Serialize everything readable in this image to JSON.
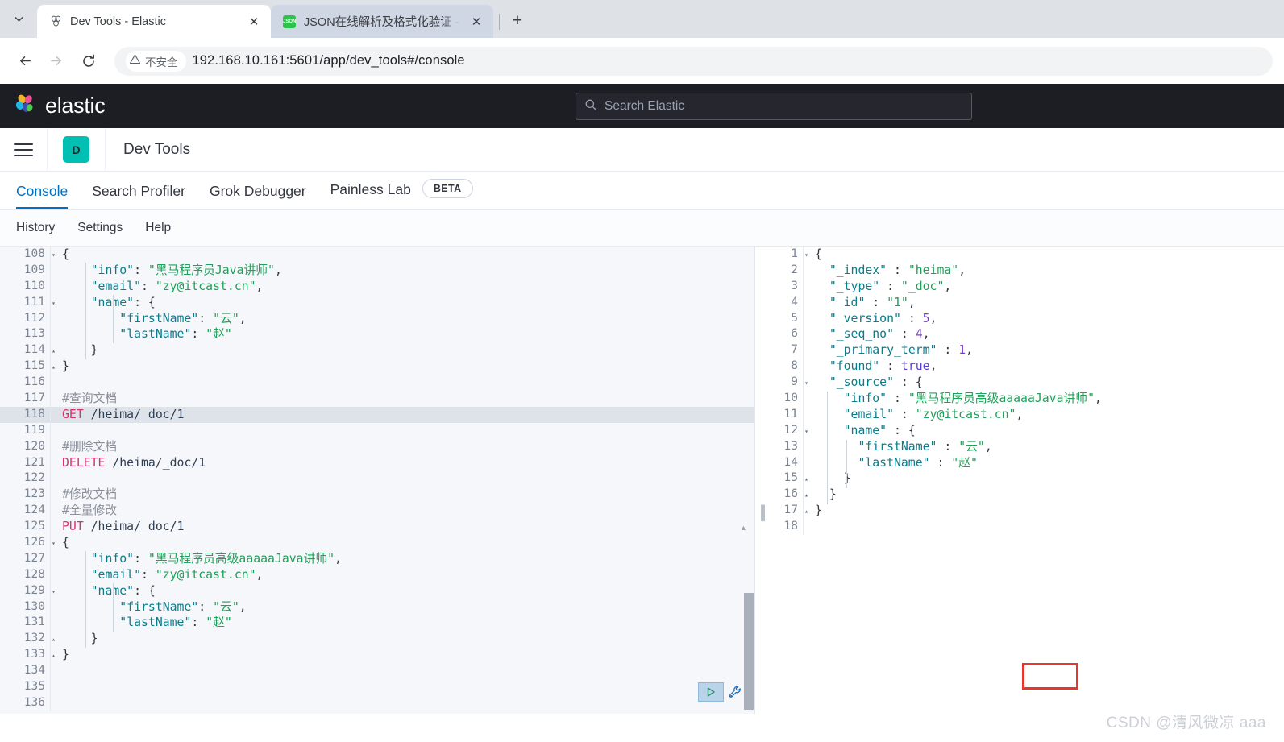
{
  "browser": {
    "tab_list_icon": "chevron-down-icon",
    "tabs": [
      {
        "title": "Dev Tools - Elastic",
        "favicon": "elastic-favicon",
        "active": true,
        "close_label": "✕"
      },
      {
        "title": "JSON在线解析及格式化验证 - J",
        "favicon": "json-favicon",
        "active": false,
        "close_label": "✕"
      }
    ],
    "new_tab_label": "+",
    "back_label": "←",
    "forward_label": "→",
    "reload_label": "⟳",
    "security_label": "不安全",
    "security_icon": "warning-triangle-icon",
    "url": "192.168.10.161:5601/app/dev_tools#/console"
  },
  "elastic": {
    "brand_name": "elastic",
    "brand_icon": "elastic-logo-icon",
    "search_placeholder": "Search Elastic",
    "search_icon": "search-icon",
    "menu_icon": "hamburger-menu-icon",
    "app_avatar_letter": "D",
    "app_title": "Dev Tools",
    "accent_color": "#0071c2",
    "avatar_color": "#00bfb3",
    "tabs": [
      {
        "label": "Console",
        "active": true,
        "badge": null
      },
      {
        "label": "Search Profiler",
        "active": false,
        "badge": null
      },
      {
        "label": "Grok Debugger",
        "active": false,
        "badge": null
      },
      {
        "label": "Painless Lab",
        "active": false,
        "badge": "BETA"
      }
    ],
    "subnav": [
      {
        "label": "History"
      },
      {
        "label": "Settings"
      },
      {
        "label": "Help"
      }
    ]
  },
  "console": {
    "run_icon": "play-triangle-icon",
    "wrench_icon": "wrench-icon",
    "divider_icon": "resize-handle-icon",
    "active_line": 118,
    "editor_lines": [
      {
        "num": "108",
        "fold": "▾",
        "tokens": [
          {
            "t": "{",
            "c": "p"
          }
        ]
      },
      {
        "num": "109",
        "fold": "",
        "tokens": [
          {
            "t": "    ",
            "c": "p"
          },
          {
            "t": "\"info\"",
            "c": "k"
          },
          {
            "t": ": ",
            "c": "p"
          },
          {
            "t": "\"黑马程序员Java讲师\"",
            "c": "s"
          },
          {
            "t": ",",
            "c": "p"
          }
        ]
      },
      {
        "num": "110",
        "fold": "",
        "tokens": [
          {
            "t": "    ",
            "c": "p"
          },
          {
            "t": "\"email\"",
            "c": "k"
          },
          {
            "t": ": ",
            "c": "p"
          },
          {
            "t": "\"zy@itcast.cn\"",
            "c": "s"
          },
          {
            "t": ",",
            "c": "p"
          }
        ]
      },
      {
        "num": "111",
        "fold": "▾",
        "tokens": [
          {
            "t": "    ",
            "c": "p"
          },
          {
            "t": "\"name\"",
            "c": "k"
          },
          {
            "t": ": ",
            "c": "p"
          },
          {
            "t": "{",
            "c": "p"
          }
        ]
      },
      {
        "num": "112",
        "fold": "",
        "tokens": [
          {
            "t": "        ",
            "c": "p"
          },
          {
            "t": "\"firstName\"",
            "c": "k"
          },
          {
            "t": ": ",
            "c": "p"
          },
          {
            "t": "\"云\"",
            "c": "s"
          },
          {
            "t": ",",
            "c": "p"
          }
        ]
      },
      {
        "num": "113",
        "fold": "",
        "tokens": [
          {
            "t": "        ",
            "c": "p"
          },
          {
            "t": "\"lastName\"",
            "c": "k"
          },
          {
            "t": ": ",
            "c": "p"
          },
          {
            "t": "\"赵\"",
            "c": "s"
          }
        ]
      },
      {
        "num": "114",
        "fold": "▴",
        "tokens": [
          {
            "t": "    }",
            "c": "p"
          }
        ]
      },
      {
        "num": "115",
        "fold": "▴",
        "tokens": [
          {
            "t": "}",
            "c": "p"
          }
        ]
      },
      {
        "num": "116",
        "fold": "",
        "tokens": []
      },
      {
        "num": "117",
        "fold": "",
        "tokens": [
          {
            "t": "#查询文档",
            "c": "c"
          }
        ]
      },
      {
        "num": "118",
        "fold": "",
        "tokens": [
          {
            "t": "GET",
            "c": "m"
          },
          {
            "t": " /heima/_doc/1",
            "c": "u"
          }
        ]
      },
      {
        "num": "119",
        "fold": "",
        "tokens": []
      },
      {
        "num": "120",
        "fold": "",
        "tokens": [
          {
            "t": "#删除文档",
            "c": "c"
          }
        ]
      },
      {
        "num": "121",
        "fold": "",
        "tokens": [
          {
            "t": "DELETE",
            "c": "m"
          },
          {
            "t": " /heima/_doc/1",
            "c": "u"
          }
        ]
      },
      {
        "num": "122",
        "fold": "",
        "tokens": []
      },
      {
        "num": "123",
        "fold": "",
        "tokens": [
          {
            "t": "#修改文档",
            "c": "c"
          }
        ]
      },
      {
        "num": "124",
        "fold": "",
        "tokens": [
          {
            "t": "#全量修改",
            "c": "c"
          }
        ]
      },
      {
        "num": "125",
        "fold": "",
        "tokens": [
          {
            "t": "PUT",
            "c": "m"
          },
          {
            "t": " /heima/_doc/1",
            "c": "u"
          }
        ]
      },
      {
        "num": "126",
        "fold": "▾",
        "tokens": [
          {
            "t": "{",
            "c": "p"
          }
        ]
      },
      {
        "num": "127",
        "fold": "",
        "tokens": [
          {
            "t": "    ",
            "c": "p"
          },
          {
            "t": "\"info\"",
            "c": "k"
          },
          {
            "t": ": ",
            "c": "p"
          },
          {
            "t": "\"黑马程序员高级aaaaaJava讲师\"",
            "c": "s"
          },
          {
            "t": ",",
            "c": "p"
          }
        ]
      },
      {
        "num": "128",
        "fold": "",
        "tokens": [
          {
            "t": "    ",
            "c": "p"
          },
          {
            "t": "\"email\"",
            "c": "k"
          },
          {
            "t": ": ",
            "c": "p"
          },
          {
            "t": "\"zy@itcast.cn\"",
            "c": "s"
          },
          {
            "t": ",",
            "c": "p"
          }
        ]
      },
      {
        "num": "129",
        "fold": "▾",
        "tokens": [
          {
            "t": "    ",
            "c": "p"
          },
          {
            "t": "\"name\"",
            "c": "k"
          },
          {
            "t": ": ",
            "c": "p"
          },
          {
            "t": "{",
            "c": "p"
          }
        ]
      },
      {
        "num": "130",
        "fold": "",
        "tokens": [
          {
            "t": "        ",
            "c": "p"
          },
          {
            "t": "\"firstName\"",
            "c": "k"
          },
          {
            "t": ": ",
            "c": "p"
          },
          {
            "t": "\"云\"",
            "c": "s"
          },
          {
            "t": ",",
            "c": "p"
          }
        ]
      },
      {
        "num": "131",
        "fold": "",
        "tokens": [
          {
            "t": "        ",
            "c": "p"
          },
          {
            "t": "\"lastName\"",
            "c": "k"
          },
          {
            "t": ": ",
            "c": "p"
          },
          {
            "t": "\"赵\"",
            "c": "s"
          }
        ]
      },
      {
        "num": "132",
        "fold": "▴",
        "tokens": [
          {
            "t": "    }",
            "c": "p"
          }
        ]
      },
      {
        "num": "133",
        "fold": "▴",
        "tokens": [
          {
            "t": "}",
            "c": "p"
          }
        ]
      },
      {
        "num": "134",
        "fold": "",
        "tokens": []
      },
      {
        "num": "135",
        "fold": "",
        "tokens": []
      },
      {
        "num": "136",
        "fold": "",
        "tokens": []
      }
    ],
    "response_lines": [
      {
        "num": "1",
        "fold": "▾",
        "tokens": [
          {
            "t": "{",
            "c": "p"
          }
        ]
      },
      {
        "num": "2",
        "fold": "",
        "tokens": [
          {
            "t": "  ",
            "c": "p"
          },
          {
            "t": "\"_index\"",
            "c": "k"
          },
          {
            "t": " : ",
            "c": "p"
          },
          {
            "t": "\"heima\"",
            "c": "s"
          },
          {
            "t": ",",
            "c": "p"
          }
        ]
      },
      {
        "num": "3",
        "fold": "",
        "tokens": [
          {
            "t": "  ",
            "c": "p"
          },
          {
            "t": "\"_type\"",
            "c": "k"
          },
          {
            "t": " : ",
            "c": "p"
          },
          {
            "t": "\"_doc\"",
            "c": "s"
          },
          {
            "t": ",",
            "c": "p"
          }
        ]
      },
      {
        "num": "4",
        "fold": "",
        "tokens": [
          {
            "t": "  ",
            "c": "p"
          },
          {
            "t": "\"_id\"",
            "c": "k"
          },
          {
            "t": " : ",
            "c": "p"
          },
          {
            "t": "\"1\"",
            "c": "s"
          },
          {
            "t": ",",
            "c": "p"
          }
        ]
      },
      {
        "num": "5",
        "fold": "",
        "tokens": [
          {
            "t": "  ",
            "c": "p"
          },
          {
            "t": "\"_version\"",
            "c": "k"
          },
          {
            "t": " : ",
            "c": "p"
          },
          {
            "t": "5",
            "c": "n"
          },
          {
            "t": ",",
            "c": "p"
          }
        ]
      },
      {
        "num": "6",
        "fold": "",
        "tokens": [
          {
            "t": "  ",
            "c": "p"
          },
          {
            "t": "\"_seq_no\"",
            "c": "k"
          },
          {
            "t": " : ",
            "c": "p"
          },
          {
            "t": "4",
            "c": "n"
          },
          {
            "t": ",",
            "c": "p"
          }
        ]
      },
      {
        "num": "7",
        "fold": "",
        "tokens": [
          {
            "t": "  ",
            "c": "p"
          },
          {
            "t": "\"_primary_term\"",
            "c": "k"
          },
          {
            "t": " : ",
            "c": "p"
          },
          {
            "t": "1",
            "c": "n"
          },
          {
            "t": ",",
            "c": "p"
          }
        ]
      },
      {
        "num": "8",
        "fold": "",
        "tokens": [
          {
            "t": "  ",
            "c": "p"
          },
          {
            "t": "\"found\"",
            "c": "k"
          },
          {
            "t": " : ",
            "c": "p"
          },
          {
            "t": "true",
            "c": "b"
          },
          {
            "t": ",",
            "c": "p"
          }
        ]
      },
      {
        "num": "9",
        "fold": "▾",
        "tokens": [
          {
            "t": "  ",
            "c": "p"
          },
          {
            "t": "\"_source\"",
            "c": "k"
          },
          {
            "t": " : ",
            "c": "p"
          },
          {
            "t": "{",
            "c": "p"
          }
        ]
      },
      {
        "num": "10",
        "fold": "",
        "tokens": [
          {
            "t": "    ",
            "c": "p"
          },
          {
            "t": "\"info\"",
            "c": "k"
          },
          {
            "t": " : ",
            "c": "p"
          },
          {
            "t": "\"黑马程序员高级aaaaaJava讲师\"",
            "c": "s"
          },
          {
            "t": ",",
            "c": "p"
          }
        ]
      },
      {
        "num": "11",
        "fold": "",
        "tokens": [
          {
            "t": "    ",
            "c": "p"
          },
          {
            "t": "\"email\"",
            "c": "k"
          },
          {
            "t": " : ",
            "c": "p"
          },
          {
            "t": "\"zy@itcast.cn\"",
            "c": "s"
          },
          {
            "t": ",",
            "c": "p"
          }
        ]
      },
      {
        "num": "12",
        "fold": "▾",
        "tokens": [
          {
            "t": "    ",
            "c": "p"
          },
          {
            "t": "\"name\"",
            "c": "k"
          },
          {
            "t": " : ",
            "c": "p"
          },
          {
            "t": "{",
            "c": "p"
          }
        ]
      },
      {
        "num": "13",
        "fold": "",
        "tokens": [
          {
            "t": "      ",
            "c": "p"
          },
          {
            "t": "\"firstName\"",
            "c": "k"
          },
          {
            "t": " : ",
            "c": "p"
          },
          {
            "t": "\"云\"",
            "c": "s"
          },
          {
            "t": ",",
            "c": "p"
          }
        ]
      },
      {
        "num": "14",
        "fold": "",
        "tokens": [
          {
            "t": "      ",
            "c": "p"
          },
          {
            "t": "\"lastName\"",
            "c": "k"
          },
          {
            "t": " : ",
            "c": "p"
          },
          {
            "t": "\"赵\"",
            "c": "s"
          }
        ]
      },
      {
        "num": "15",
        "fold": "▴",
        "tokens": [
          {
            "t": "    }",
            "c": "p"
          }
        ]
      },
      {
        "num": "16",
        "fold": "▴",
        "tokens": [
          {
            "t": "  }",
            "c": "p"
          }
        ]
      },
      {
        "num": "17",
        "fold": "▴",
        "tokens": [
          {
            "t": "}",
            "c": "p"
          }
        ]
      },
      {
        "num": "18",
        "fold": "",
        "tokens": []
      }
    ],
    "annotation": {
      "type": "red-rectangle-highlight",
      "color": "#e8362a"
    }
  },
  "watermark": "CSDN @清风微凉 aaa"
}
